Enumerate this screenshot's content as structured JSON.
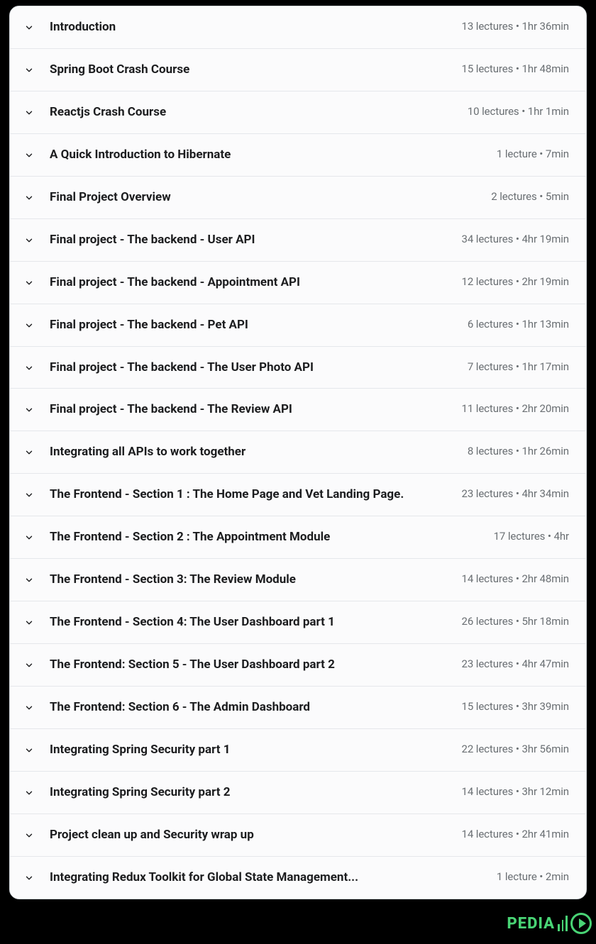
{
  "sections": [
    {
      "title": "Introduction",
      "meta": "13 lectures • 1hr 36min"
    },
    {
      "title": "Spring Boot Crash Course",
      "meta": "15 lectures • 1hr 48min"
    },
    {
      "title": "Reactjs Crash Course",
      "meta": "10 lectures • 1hr 1min"
    },
    {
      "title": "A Quick Introduction to Hibernate",
      "meta": "1 lecture • 7min"
    },
    {
      "title": "Final Project Overview",
      "meta": "2 lectures • 5min"
    },
    {
      "title": "Final project - The backend - User API",
      "meta": "34 lectures • 4hr 19min"
    },
    {
      "title": "Final project - The backend - Appointment API",
      "meta": "12 lectures • 2hr 19min"
    },
    {
      "title": "Final project - The backend - Pet API",
      "meta": "6 lectures • 1hr 13min"
    },
    {
      "title": "Final project - The backend - The User Photo API",
      "meta": "7 lectures • 1hr 17min"
    },
    {
      "title": "Final project - The backend - The Review API",
      "meta": "11 lectures • 2hr 20min"
    },
    {
      "title": "Integrating all APIs to work together",
      "meta": "8 lectures • 1hr 26min"
    },
    {
      "title": "The Frontend - Section 1 : The Home Page and Vet Landing Page.",
      "meta": "23 lectures • 4hr 34min"
    },
    {
      "title": "The Frontend - Section 2 : The Appointment Module",
      "meta": "17 lectures • 4hr"
    },
    {
      "title": "The Frontend - Section 3: The Review Module",
      "meta": "14 lectures • 2hr 48min"
    },
    {
      "title": "The Frontend - Section 4: The User Dashboard part 1",
      "meta": "26 lectures • 5hr 18min"
    },
    {
      "title": "The Frontend: Section 5 - The User Dashboard part 2",
      "meta": "23 lectures • 4hr 47min"
    },
    {
      "title": "The Frontend: Section 6 - The Admin Dashboard",
      "meta": "15 lectures • 3hr 39min"
    },
    {
      "title": "Integrating Spring Security part 1",
      "meta": "22 lectures • 3hr 56min"
    },
    {
      "title": "Integrating Spring Security part 2",
      "meta": "14 lectures • 3hr 12min"
    },
    {
      "title": "Project clean up and Security wrap up",
      "meta": "14 lectures • 2hr 41min"
    },
    {
      "title": "Integrating Redux Toolkit for Global State Management...",
      "meta": "1 lecture • 2min"
    }
  ],
  "watermark": {
    "text": "PEDIA"
  }
}
